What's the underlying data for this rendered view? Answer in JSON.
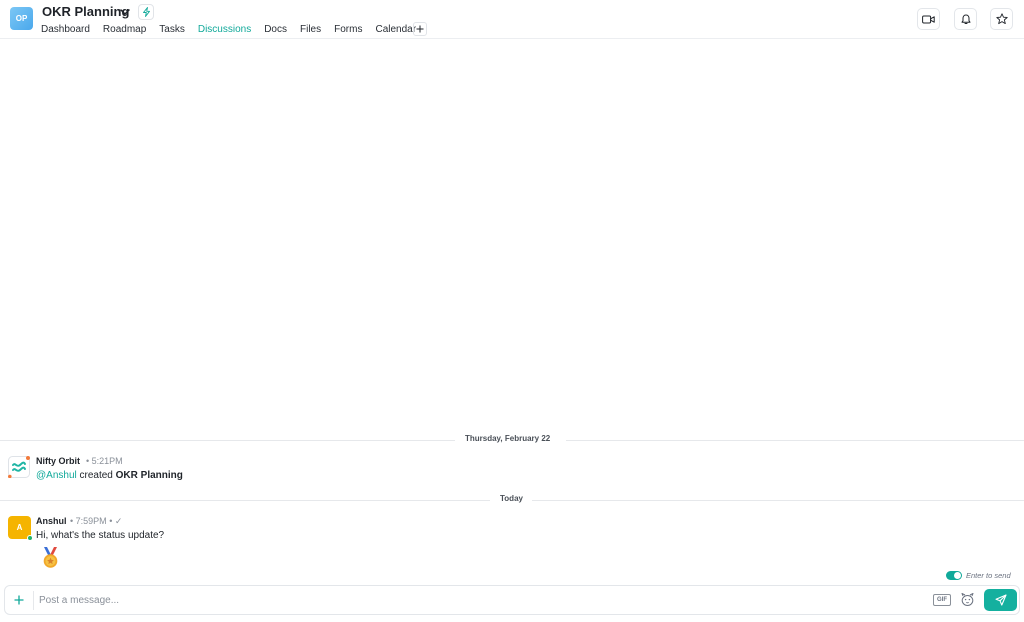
{
  "project": {
    "initials": "OP",
    "title": "OKR Planning"
  },
  "tabs": [
    {
      "label": "Dashboard"
    },
    {
      "label": "Roadmap"
    },
    {
      "label": "Tasks"
    },
    {
      "label": "Discussions",
      "active": true
    },
    {
      "label": "Docs"
    },
    {
      "label": "Files"
    },
    {
      "label": "Forms"
    },
    {
      "label": "Calendar"
    }
  ],
  "header_actions": [
    "video-icon",
    "bell-icon",
    "star-icon"
  ],
  "feed": {
    "separators": [
      {
        "label": "Thursday, February 22"
      },
      {
        "label": "Today"
      }
    ],
    "messages": [
      {
        "author": "Nifty Orbit",
        "time": "5:21PM",
        "mention": "@Anshul",
        "text": "created",
        "bold": "OKR Planning"
      },
      {
        "author": "Anshul",
        "avatar_initial": "A",
        "time": "7:59PM",
        "text": "Hi, what's the status update?",
        "reaction": "medal-emoji"
      }
    ]
  },
  "composer": {
    "enter_to_send": "Enter to send",
    "placeholder": "Post a message...",
    "gif": "GIF"
  },
  "colors": {
    "accent": "#11a99a",
    "avatar_yellow": "#f5b400",
    "online": "#21b36b"
  }
}
